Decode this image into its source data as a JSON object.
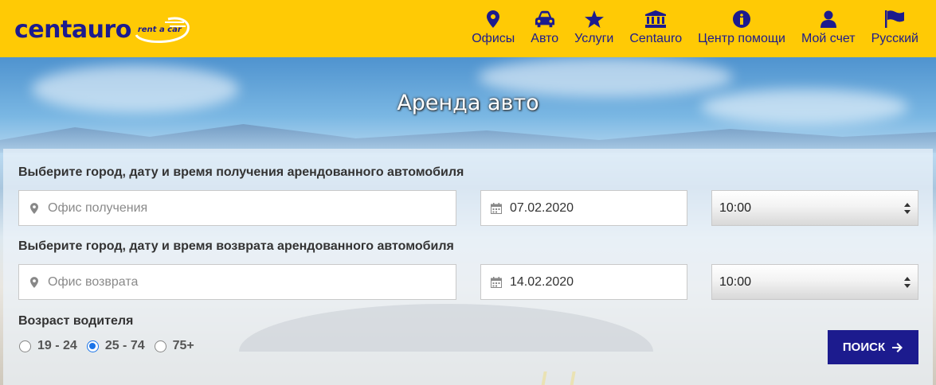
{
  "brand": {
    "name": "centauro",
    "tagline": "rent a car",
    "color": "#1c1b8e",
    "header_bg": "#ffca05"
  },
  "nav": [
    {
      "label": "Офисы",
      "icon": "map-marker-icon"
    },
    {
      "label": "Авто",
      "icon": "car-icon"
    },
    {
      "label": "Услуги",
      "icon": "star-icon"
    },
    {
      "label": "Centauro",
      "icon": "bank-icon"
    },
    {
      "label": "Центр помощи",
      "icon": "info-circle-icon"
    },
    {
      "label": "Мой счет",
      "icon": "user-icon"
    },
    {
      "label": "Русский",
      "icon": "flag-icon"
    }
  ],
  "hero": {
    "title": "Аренда авто"
  },
  "pickup": {
    "label": "Выберите город, дату и время получения арендованного автомобиля",
    "office_placeholder": "Офис получения",
    "date": "07.02.2020",
    "time": "10:00"
  },
  "return": {
    "label": "Выберите город, дату и время возврата арендованного автомобиля",
    "office_placeholder": "Офис возврата",
    "date": "14.02.2020",
    "time": "10:00"
  },
  "driver_age": {
    "label": "Возраст водителя",
    "options": [
      {
        "label": "19 - 24",
        "selected": false
      },
      {
        "label": "25 - 74",
        "selected": true
      },
      {
        "label": "75+",
        "selected": false
      }
    ]
  },
  "search_button": {
    "label": "ПОИСК",
    "icon": "arrow-right-icon"
  }
}
